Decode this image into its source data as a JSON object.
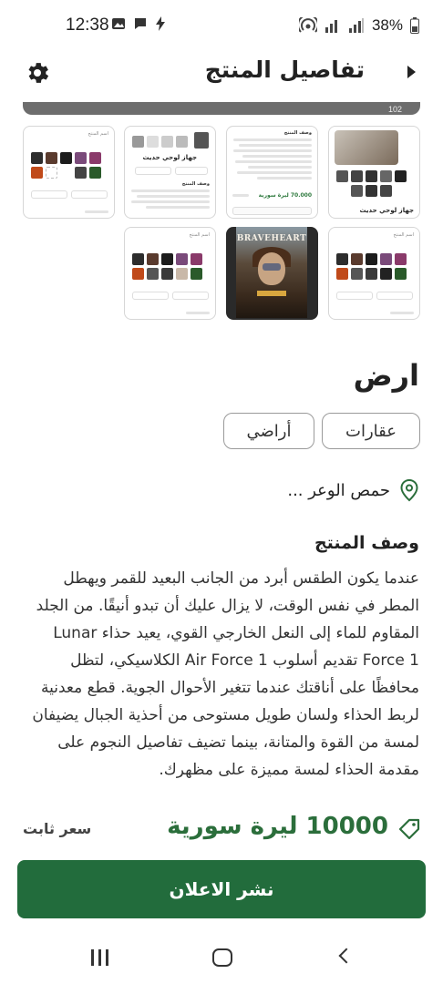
{
  "status_bar": {
    "time": "12:38",
    "battery": "38%"
  },
  "header": {
    "title": "تفاصيل المنتج"
  },
  "gallery": {
    "strip_text": "102",
    "thumbnails": [
      {
        "type": "screenshot",
        "title_text": "جهاز لوحي حديث",
        "price_text": "70.000 ليرة سورية",
        "desc_label": "وصف المنتج"
      },
      {
        "type": "screenshot",
        "title_text": "جهاز لوحي حديث",
        "price_text": "70.000 ليرة سورية",
        "desc_label": "وصف المنتج"
      },
      {
        "type": "screenshot",
        "title_text": "جهاز لوحي حديث",
        "desc_label": "وصف المنتج"
      },
      {
        "type": "screenshot",
        "title_text": "اسم المنتج"
      },
      {
        "type": "screenshot",
        "title_text": "اسم المنتج"
      },
      {
        "type": "poster",
        "poster_title": "BRAVEHEART"
      },
      {
        "type": "screenshot",
        "title_text": "اسم المنتج"
      }
    ]
  },
  "product": {
    "name": "ارض",
    "categories": [
      "عقارات",
      "أراضي"
    ],
    "location": "حمص الوعر ...",
    "description_heading": "وصف المنتج",
    "description": "عندما يكون الطقس أبرد من الجانب البعيد للقمر ويهطل المطر في نفس الوقت، لا يزال عليك أن تبدو أنيقًا. من الجلد المقاوم للماء إلى النعل الخارجي القوي، يعيد حذاء Lunar Force 1 تقديم أسلوب Air Force 1 الكلاسيكي، لتظل محافظًا على أناقتك عندما تتغير الأحوال الجوية. قطع معدنية لربط الحذاء ولسان طويل مستوحى من أحذية الجبال يضيفان لمسة من القوة والمتانة، بينما تضيف تفاصيل النجوم على مقدمة الحذاء لمسة مميزة على مظهرك.",
    "price": "10000 ليرة سورية",
    "price_type": "سعر ثابت"
  },
  "actions": {
    "publish_label": "نشر الاعلان"
  },
  "colors": {
    "primary": "#226c3c",
    "price": "#2b6e3b"
  }
}
